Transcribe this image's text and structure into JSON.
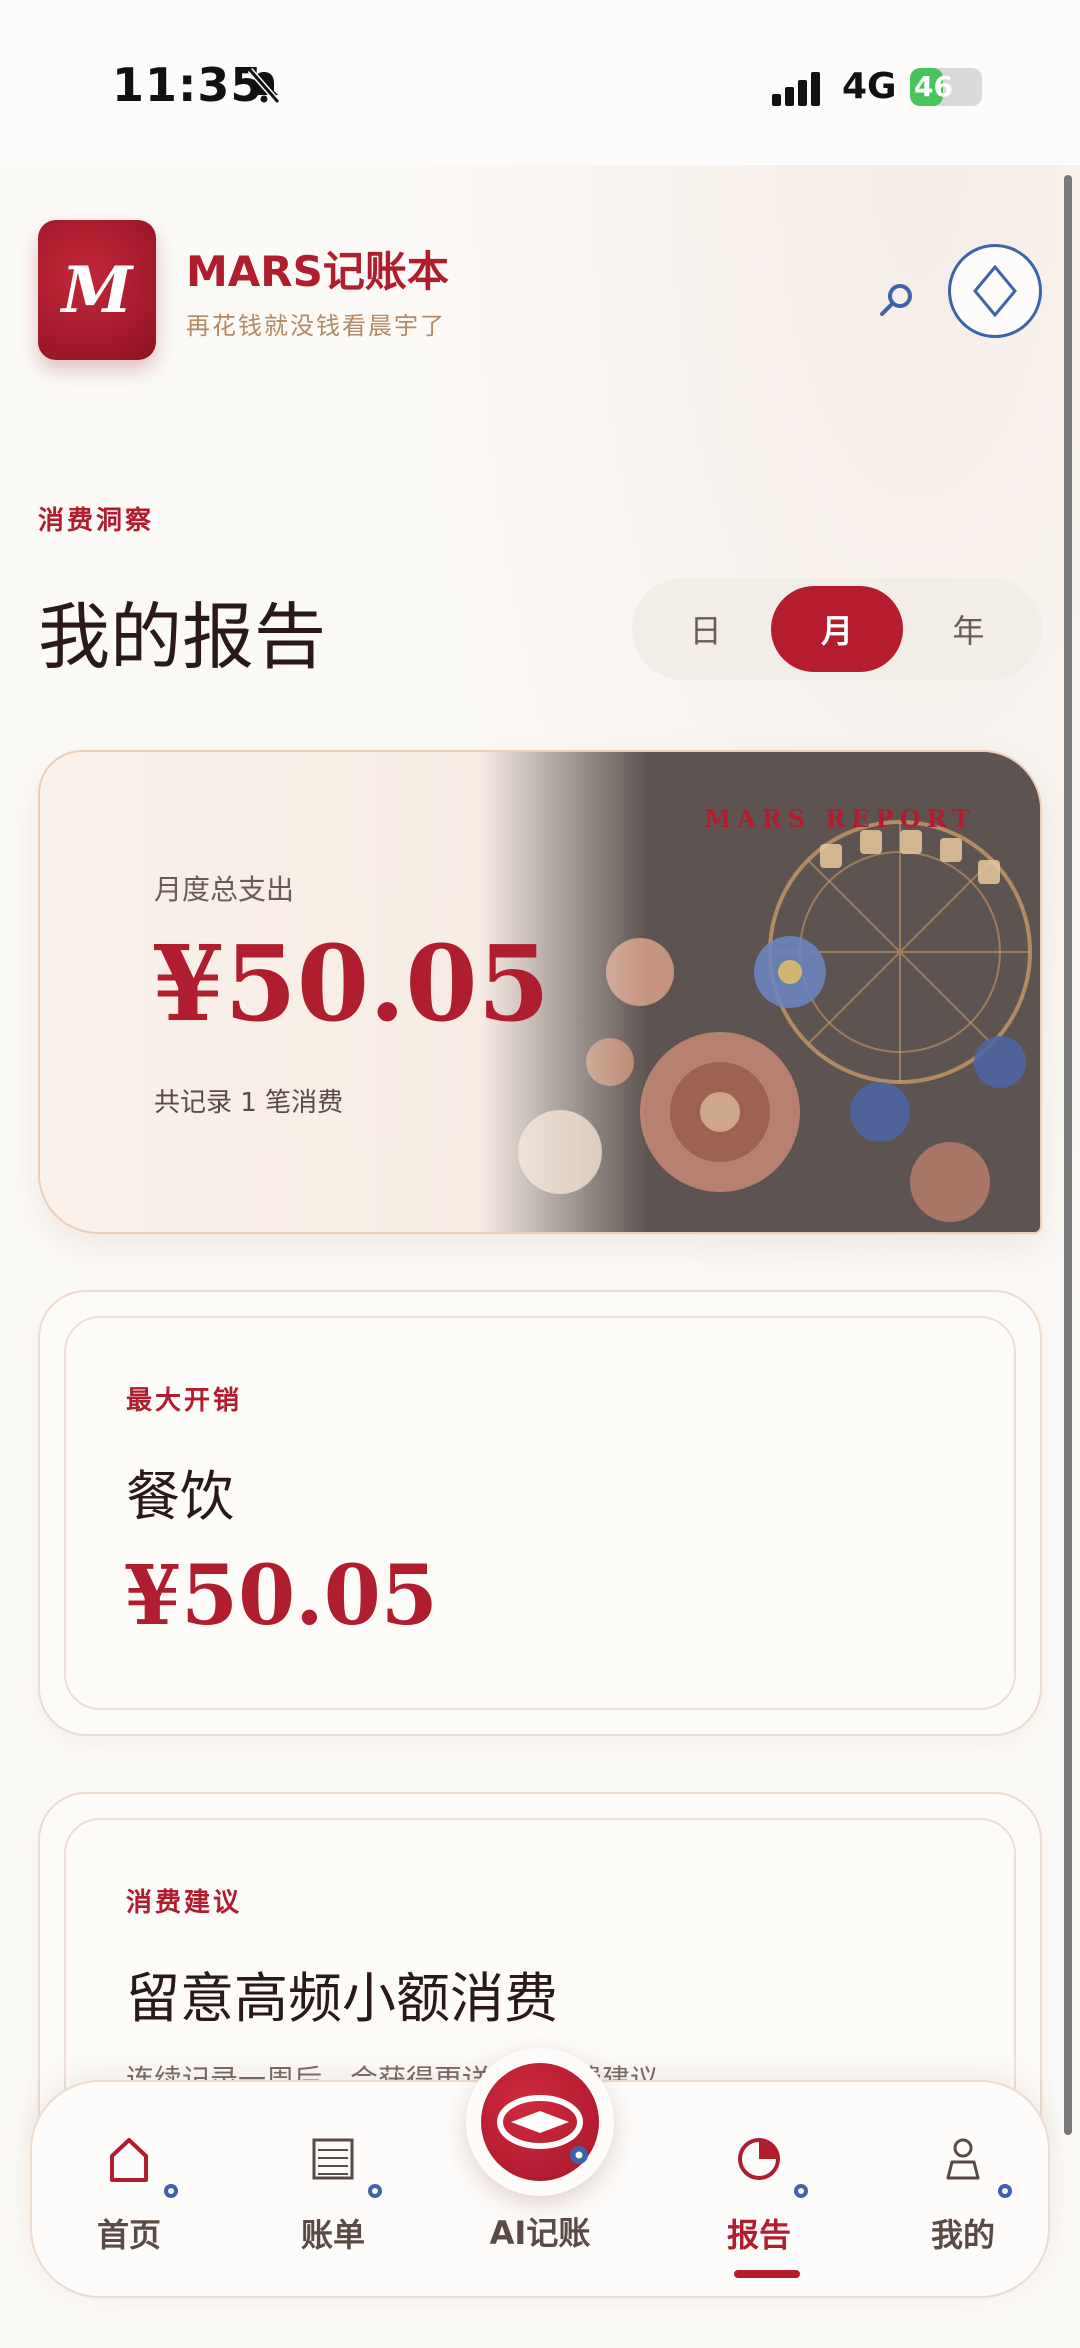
{
  "status_bar": {
    "time": "11:35",
    "network": "4G",
    "battery": "46",
    "battery_level": 0.46
  },
  "header": {
    "logo_letter": "M",
    "app_title": "MARS记账本",
    "app_subtitle": "再花钱就没钱看晨宇了",
    "search_icon": "search-icon",
    "action_icon": "diamond-icon"
  },
  "section_label": "消费洞察",
  "page_title": "我的报告",
  "period_tabs": {
    "items": [
      "日",
      "月",
      "年"
    ],
    "active": "月"
  },
  "hero": {
    "brand": "MARS REPORT",
    "label": "月度总支出",
    "amount": "¥50.05",
    "note": "共记录 1 笔消费"
  },
  "top_expense": {
    "label": "最大开销",
    "category": "餐饮",
    "amount": "¥50.05"
  },
  "suggestion": {
    "label": "消费建议",
    "title": "留意高频小额消费",
    "desc": "连续记录一周后，会获得更详细的消费建议"
  },
  "tabbar": {
    "items": [
      {
        "label": "首页",
        "icon": "home-icon"
      },
      {
        "label": "账单",
        "icon": "list-icon"
      },
      {
        "label": "AI记账",
        "icon": "ai-icon"
      },
      {
        "label": "报告",
        "icon": "chart-icon"
      },
      {
        "label": "我的",
        "icon": "profile-icon"
      }
    ],
    "active": "报告"
  },
  "colors": {
    "accent": "#b51d2f",
    "secondary": "#3f63a8",
    "gold": "#b38a66"
  }
}
